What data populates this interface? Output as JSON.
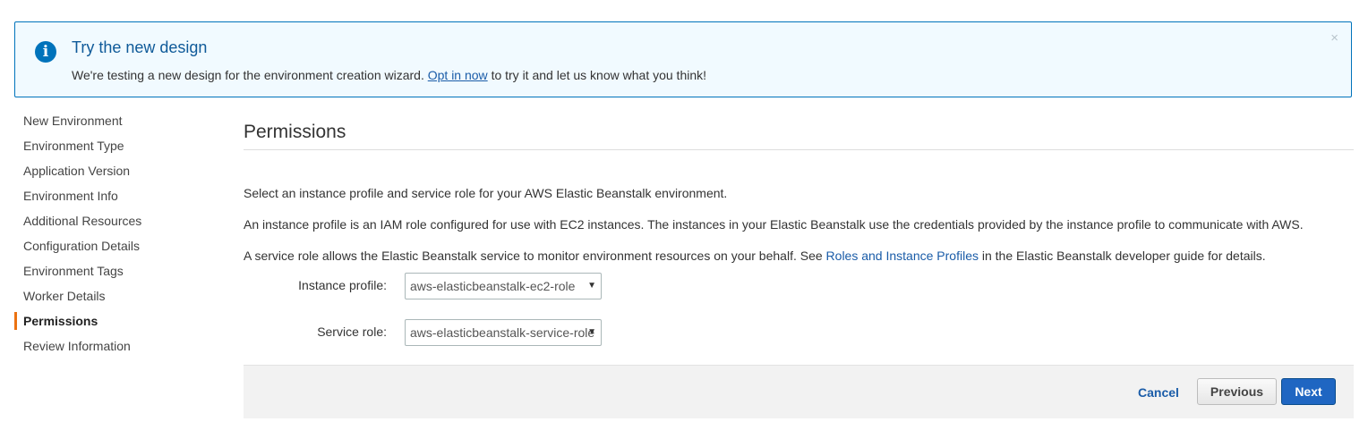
{
  "banner": {
    "icon": "info-icon",
    "icon_glyph": "i",
    "title": "Try the new design",
    "text_before": "We're testing a new design for the environment creation wizard.",
    "link_text": "Opt in now",
    "text_after": "to try it and let us know what you think!",
    "close_glyph": "×"
  },
  "sidebar": {
    "items": [
      {
        "label": "New Environment",
        "active": false
      },
      {
        "label": "Environment Type",
        "active": false
      },
      {
        "label": "Application Version",
        "active": false
      },
      {
        "label": "Environment Info",
        "active": false
      },
      {
        "label": "Additional Resources",
        "active": false
      },
      {
        "label": "Configuration Details",
        "active": false
      },
      {
        "label": "Environment Tags",
        "active": false
      },
      {
        "label": "Worker Details",
        "active": false
      },
      {
        "label": "Permissions",
        "active": true
      },
      {
        "label": "Review Information",
        "active": false
      }
    ]
  },
  "main": {
    "title": "Permissions",
    "para1": "Select an instance profile and service role for your AWS Elastic Beanstalk environment.",
    "para2": "An instance profile is an IAM role configured for use with EC2 instances. The instances in your Elastic Beanstalk use the credentials provided by the instance profile to communicate with AWS.",
    "para3_before": "A service role allows the Elastic Beanstalk service to monitor environment resources on your behalf. See",
    "para3_link": "Roles and Instance Profiles",
    "para3_after": "in the Elastic Beanstalk developer guide for details.",
    "instance_profile_label": "Instance profile:",
    "instance_profile_value": "aws-elasticbeanstalk-ec2-role",
    "service_role_label": "Service role:",
    "service_role_value": "aws-elasticbeanstalk-service-role",
    "caret_glyph": "▼"
  },
  "footer": {
    "cancel_label": "Cancel",
    "previous_label": "Previous",
    "next_label": "Next"
  },
  "colors": {
    "accent": "#ec7211",
    "link": "#1a5ca8",
    "primary_button": "#1f66c2",
    "banner_border": "#0073bb",
    "banner_bg": "#f1faff"
  }
}
